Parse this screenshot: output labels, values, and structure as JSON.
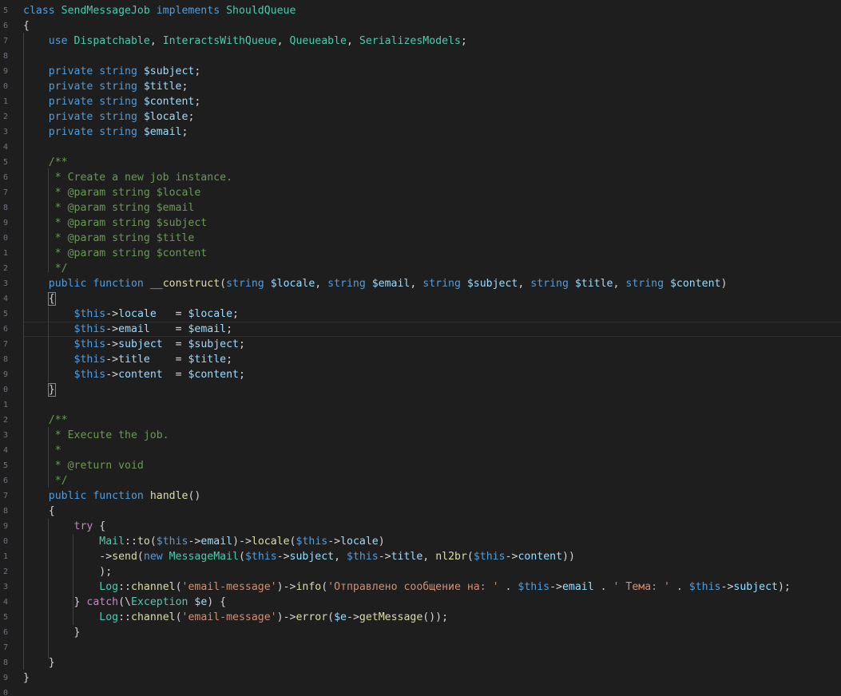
{
  "colors": {
    "background": "#1e1e1e",
    "keyword": "#569cd6",
    "control": "#c586c0",
    "class": "#4ec9b0",
    "variable": "#9cdcfe",
    "function": "#dcdcaa",
    "string": "#ce9178",
    "comment": "#6a9955",
    "plain": "#d4d4d4"
  },
  "gutter": {
    "line_numbers": [
      "5",
      "6",
      "7",
      "8",
      "9",
      "0",
      "1",
      "2",
      "3",
      "4",
      "5",
      "6",
      "7",
      "8",
      "9",
      "0",
      "1",
      "2",
      "3",
      "4",
      "5",
      "6",
      "7",
      "8",
      "9",
      "0",
      "1",
      "2",
      "3",
      "4",
      "5",
      "6",
      "7",
      "8",
      "9",
      "0",
      "1",
      "2",
      "3",
      "4",
      "5",
      "6",
      "7",
      "8",
      "9",
      "0"
    ]
  },
  "code_lines": [
    [
      [
        "class ",
        "keyword"
      ],
      [
        "SendMessageJob ",
        "class"
      ],
      [
        "implements ",
        "keyword"
      ],
      [
        "ShouldQueue",
        "class"
      ]
    ],
    [
      [
        "{",
        "plain"
      ]
    ],
    [
      [
        "    use ",
        "keyword"
      ],
      [
        "Dispatchable",
        "class"
      ],
      [
        ", ",
        "plain"
      ],
      [
        "InteractsWithQueue",
        "class"
      ],
      [
        ", ",
        "plain"
      ],
      [
        "Queueable",
        "class"
      ],
      [
        ", ",
        "plain"
      ],
      [
        "SerializesModels",
        "class"
      ],
      [
        ";",
        "plain"
      ]
    ],
    [],
    [
      [
        "    private ",
        "keyword"
      ],
      [
        "string ",
        "keyword"
      ],
      [
        "$subject",
        "var"
      ],
      [
        ";",
        "plain"
      ]
    ],
    [
      [
        "    private ",
        "keyword"
      ],
      [
        "string ",
        "keyword"
      ],
      [
        "$title",
        "var"
      ],
      [
        ";",
        "plain"
      ]
    ],
    [
      [
        "    private ",
        "keyword"
      ],
      [
        "string ",
        "keyword"
      ],
      [
        "$content",
        "var"
      ],
      [
        ";",
        "plain"
      ]
    ],
    [
      [
        "    private ",
        "keyword"
      ],
      [
        "string ",
        "keyword"
      ],
      [
        "$locale",
        "var"
      ],
      [
        ";",
        "plain"
      ]
    ],
    [
      [
        "    private ",
        "keyword"
      ],
      [
        "string ",
        "keyword"
      ],
      [
        "$email",
        "var"
      ],
      [
        ";",
        "plain"
      ]
    ],
    [],
    [
      [
        "    /**",
        "comment"
      ]
    ],
    [
      [
        "     * Create a new job instance.",
        "comment"
      ]
    ],
    [
      [
        "     * @param string $locale",
        "comment"
      ]
    ],
    [
      [
        "     * @param string $email",
        "comment"
      ]
    ],
    [
      [
        "     * @param string $subject",
        "comment"
      ]
    ],
    [
      [
        "     * @param string $title",
        "comment"
      ]
    ],
    [
      [
        "     * @param string $content",
        "comment"
      ]
    ],
    [
      [
        "     */",
        "comment"
      ]
    ],
    [
      [
        "    public ",
        "keyword"
      ],
      [
        "function ",
        "keyword"
      ],
      [
        "__construct",
        "func"
      ],
      [
        "(",
        "plain"
      ],
      [
        "string ",
        "keyword"
      ],
      [
        "$locale",
        "var"
      ],
      [
        ", ",
        "plain"
      ],
      [
        "string ",
        "keyword"
      ],
      [
        "$email",
        "var"
      ],
      [
        ", ",
        "plain"
      ],
      [
        "string ",
        "keyword"
      ],
      [
        "$subject",
        "var"
      ],
      [
        ", ",
        "plain"
      ],
      [
        "string ",
        "keyword"
      ],
      [
        "$title",
        "var"
      ],
      [
        ", ",
        "plain"
      ],
      [
        "string ",
        "keyword"
      ],
      [
        "$content",
        "var"
      ],
      [
        ")",
        "plain"
      ]
    ],
    [
      [
        "    ",
        "plain"
      ],
      [
        "{",
        "plain",
        "bracket"
      ]
    ],
    [
      [
        "        ",
        "plain"
      ],
      [
        "$this",
        "this"
      ],
      [
        "->",
        "plain"
      ],
      [
        "locale",
        "var"
      ],
      [
        "   = ",
        "plain"
      ],
      [
        "$locale",
        "var"
      ],
      [
        ";",
        "plain"
      ]
    ],
    [
      [
        "        ",
        "plain"
      ],
      [
        "$this",
        "this"
      ],
      [
        "->",
        "plain"
      ],
      [
        "email",
        "var"
      ],
      [
        "    = ",
        "plain"
      ],
      [
        "$email",
        "var"
      ],
      [
        ";",
        "plain"
      ]
    ],
    [
      [
        "        ",
        "plain"
      ],
      [
        "$this",
        "this"
      ],
      [
        "->",
        "plain"
      ],
      [
        "subject",
        "var"
      ],
      [
        "  = ",
        "plain"
      ],
      [
        "$subject",
        "var"
      ],
      [
        ";",
        "plain"
      ]
    ],
    [
      [
        "        ",
        "plain"
      ],
      [
        "$this",
        "this"
      ],
      [
        "->",
        "plain"
      ],
      [
        "title",
        "var"
      ],
      [
        "    = ",
        "plain"
      ],
      [
        "$title",
        "var"
      ],
      [
        ";",
        "plain"
      ]
    ],
    [
      [
        "        ",
        "plain"
      ],
      [
        "$this",
        "this"
      ],
      [
        "->",
        "plain"
      ],
      [
        "content",
        "var"
      ],
      [
        "  = ",
        "plain"
      ],
      [
        "$content",
        "var"
      ],
      [
        ";",
        "plain"
      ]
    ],
    [
      [
        "    ",
        "plain"
      ],
      [
        "}",
        "plain",
        "bracket"
      ]
    ],
    [],
    [
      [
        "    /**",
        "comment"
      ]
    ],
    [
      [
        "     * Execute the job.",
        "comment"
      ]
    ],
    [
      [
        "     *",
        "comment"
      ]
    ],
    [
      [
        "     * @return void",
        "comment"
      ]
    ],
    [
      [
        "     */",
        "comment"
      ]
    ],
    [
      [
        "    public ",
        "keyword"
      ],
      [
        "function ",
        "keyword"
      ],
      [
        "handle",
        "func"
      ],
      [
        "()",
        "plain"
      ]
    ],
    [
      [
        "    {",
        "plain"
      ]
    ],
    [
      [
        "        ",
        "plain"
      ],
      [
        "try ",
        "control"
      ],
      [
        "{",
        "plain"
      ]
    ],
    [
      [
        "            ",
        "plain"
      ],
      [
        "Mail",
        "class"
      ],
      [
        "::",
        "plain"
      ],
      [
        "to",
        "func"
      ],
      [
        "(",
        "plain"
      ],
      [
        "$this",
        "this"
      ],
      [
        "->",
        "plain"
      ],
      [
        "email",
        "var"
      ],
      [
        ")->",
        "plain"
      ],
      [
        "locale",
        "func"
      ],
      [
        "(",
        "plain"
      ],
      [
        "$this",
        "this"
      ],
      [
        "->",
        "plain"
      ],
      [
        "locale",
        "var"
      ],
      [
        ")",
        "plain"
      ]
    ],
    [
      [
        "            ->",
        "plain"
      ],
      [
        "send",
        "func"
      ],
      [
        "(",
        "plain"
      ],
      [
        "new ",
        "keyword"
      ],
      [
        "MessageMail",
        "class"
      ],
      [
        "(",
        "plain"
      ],
      [
        "$this",
        "this"
      ],
      [
        "->",
        "plain"
      ],
      [
        "subject",
        "var"
      ],
      [
        ", ",
        "plain"
      ],
      [
        "$this",
        "this"
      ],
      [
        "->",
        "plain"
      ],
      [
        "title",
        "var"
      ],
      [
        ", ",
        "plain"
      ],
      [
        "nl2br",
        "func"
      ],
      [
        "(",
        "plain"
      ],
      [
        "$this",
        "this"
      ],
      [
        "->",
        "plain"
      ],
      [
        "content",
        "var"
      ],
      [
        "))",
        "plain"
      ]
    ],
    [
      [
        "            );",
        "plain"
      ]
    ],
    [
      [
        "            ",
        "plain"
      ],
      [
        "Log",
        "class"
      ],
      [
        "::",
        "plain"
      ],
      [
        "channel",
        "func"
      ],
      [
        "(",
        "plain"
      ],
      [
        "'email-message'",
        "string"
      ],
      [
        ")->",
        "plain"
      ],
      [
        "info",
        "func"
      ],
      [
        "(",
        "plain"
      ],
      [
        "'Отправлено сообщение на: '",
        "string"
      ],
      [
        " . ",
        "plain"
      ],
      [
        "$this",
        "this"
      ],
      [
        "->",
        "plain"
      ],
      [
        "email",
        "var"
      ],
      [
        " . ",
        "plain"
      ],
      [
        "' Тема: '",
        "string"
      ],
      [
        " . ",
        "plain"
      ],
      [
        "$this",
        "this"
      ],
      [
        "->",
        "plain"
      ],
      [
        "subject",
        "var"
      ],
      [
        ");",
        "plain"
      ]
    ],
    [
      [
        "        } ",
        "plain"
      ],
      [
        "catch",
        "control"
      ],
      [
        "(\\",
        "plain"
      ],
      [
        "Exception ",
        "class"
      ],
      [
        "$e",
        "var"
      ],
      [
        ") {",
        "plain"
      ]
    ],
    [
      [
        "            ",
        "plain"
      ],
      [
        "Log",
        "class"
      ],
      [
        "::",
        "plain"
      ],
      [
        "channel",
        "func"
      ],
      [
        "(",
        "plain"
      ],
      [
        "'email-message'",
        "string"
      ],
      [
        ")->",
        "plain"
      ],
      [
        "error",
        "func"
      ],
      [
        "(",
        "plain"
      ],
      [
        "$e",
        "var"
      ],
      [
        "->",
        "plain"
      ],
      [
        "getMessage",
        "func"
      ],
      [
        "());",
        "plain"
      ]
    ],
    [
      [
        "        }",
        "plain"
      ]
    ],
    [],
    [
      [
        "    }",
        "plain"
      ]
    ],
    [
      [
        "}",
        "plain"
      ]
    ],
    []
  ]
}
